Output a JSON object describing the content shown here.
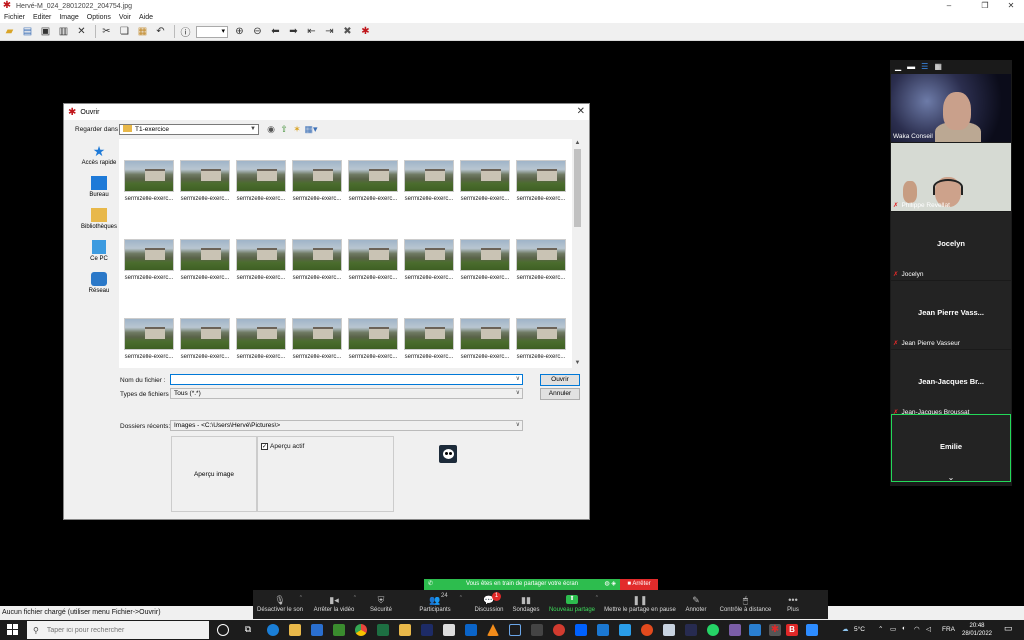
{
  "window": {
    "title": "Hervé-M_024_28012022_204754.jpg",
    "menu": [
      "Fichier",
      "Editer",
      "Image",
      "Options",
      "Voir",
      "Aide"
    ]
  },
  "viewer_status": "Aucun fichier chargé (utiliser menu Fichier->Ouvrir)",
  "dialog": {
    "title": "Ouvrir",
    "look_in_label": "Regarder dans :",
    "look_in_value": "T1-exercice",
    "places": [
      {
        "label": "Accès rapide",
        "icon": "star-icon"
      },
      {
        "label": "Bureau",
        "icon": "desktop-icon"
      },
      {
        "label": "Bibliothèques",
        "icon": "libraries-icon"
      },
      {
        "label": "Ce PC",
        "icon": "computer-icon"
      },
      {
        "label": "Réseau",
        "icon": "network-icon"
      }
    ],
    "file_caption": "sermizelle-exerc...",
    "filename_label": "Nom du fichier :",
    "filename_value": "",
    "filetype_label": "Types de fichiers :",
    "filetype_value": "Tous (*.*)",
    "open_button": "Ouvrir",
    "cancel_button": "Annuler",
    "recent_label": "Dossiers récents:",
    "recent_value": "Images  -  <C:\\Users\\Hervé\\Pictures\\>",
    "preview_label": "Aperçu image",
    "preview_checkbox": "Aperçu actif"
  },
  "gallery": {
    "tiles": [
      {
        "caption": "Waka Conseil",
        "name": ""
      },
      {
        "caption": "Philippe Revellat",
        "name": ""
      },
      {
        "caption": "Jocelyn",
        "name": "Jocelyn"
      },
      {
        "caption": "Jean Pierre Vasseur",
        "name": "Jean Pierre Vass..."
      },
      {
        "caption": "Jean-Jacques Broussat",
        "name": "Jean-Jacques  Br..."
      },
      {
        "caption": "Emilie",
        "name": "Emilie"
      }
    ]
  },
  "share": {
    "banner": "Vous êtes en train de partager votre écran",
    "stop": "Arrêter"
  },
  "zoom_bar": {
    "items": [
      {
        "label": "Désactiver le son",
        "icon": "mic-icon"
      },
      {
        "label": "Arrêter la vidéo",
        "icon": "video-icon"
      },
      {
        "label": "Sécurité",
        "icon": "shield-icon"
      },
      {
        "label": "Participants",
        "icon": "participants-icon",
        "count": "24"
      },
      {
        "label": "Discussion",
        "icon": "chat-icon",
        "badge": "1"
      },
      {
        "label": "Sondages",
        "icon": "polls-icon"
      },
      {
        "label": "Nouveau partage",
        "icon": "share-icon"
      },
      {
        "label": "Mettre le partage en pause",
        "icon": "pause-icon"
      },
      {
        "label": "Annoter",
        "icon": "annotate-icon"
      },
      {
        "label": "Contrôle à distance",
        "icon": "remote-control-icon"
      },
      {
        "label": "Plus",
        "icon": "more-icon"
      }
    ]
  },
  "taskbar": {
    "search_placeholder": "Taper ici pour rechercher",
    "weather": "5°C",
    "lang": "FRA",
    "time": "20:48",
    "date": "28/01/2022"
  },
  "colors": {
    "zoom_green": "#2dbd4e",
    "stop_red": "#e22b2b",
    "accent_blue": "#0078d7"
  }
}
